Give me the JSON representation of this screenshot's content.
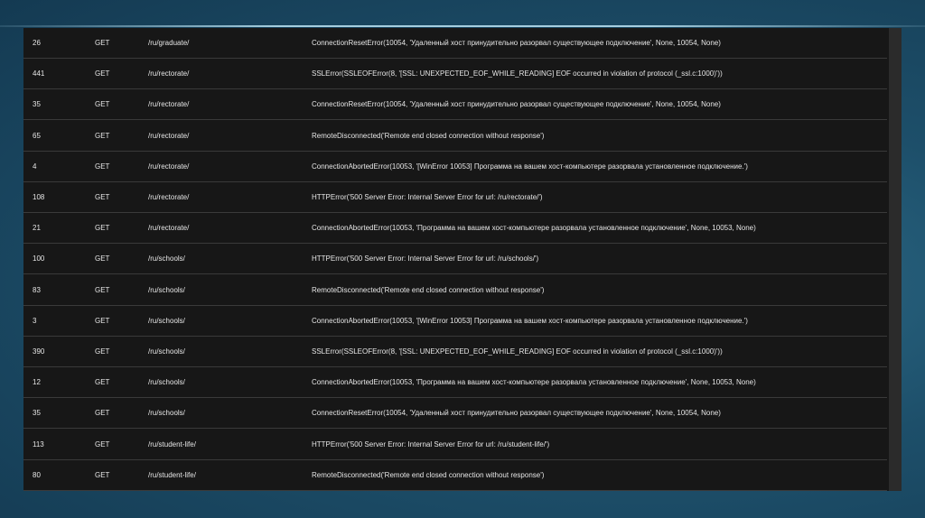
{
  "rows": [
    {
      "count": "26",
      "method": "GET",
      "url": "/ru/graduate/",
      "error": "ConnectionResetError(10054, 'Удаленный хост принудительно разорвал существующее подключение', None, 10054, None)"
    },
    {
      "count": "441",
      "method": "GET",
      "url": "/ru/rectorate/",
      "error": "SSLError(SSLEOFError(8, '[SSL: UNEXPECTED_EOF_WHILE_READING] EOF occurred in violation of protocol (_ssl.c:1000)'))"
    },
    {
      "count": "35",
      "method": "GET",
      "url": "/ru/rectorate/",
      "error": "ConnectionResetError(10054, 'Удаленный хост принудительно разорвал существующее подключение', None, 10054, None)"
    },
    {
      "count": "65",
      "method": "GET",
      "url": "/ru/rectorate/",
      "error": "RemoteDisconnected('Remote end closed connection without response')"
    },
    {
      "count": "4",
      "method": "GET",
      "url": "/ru/rectorate/",
      "error": "ConnectionAbortedError(10053, '[WinError 10053] Программа на вашем хост-компьютере разорвала установленное подключение.')"
    },
    {
      "count": "108",
      "method": "GET",
      "url": "/ru/rectorate/",
      "error": "HTTPError('500 Server Error: Internal Server Error for url: /ru/rectorate/')"
    },
    {
      "count": "21",
      "method": "GET",
      "url": "/ru/rectorate/",
      "error": "ConnectionAbortedError(10053, 'Программа на вашем хост-компьютере разорвала установленное подключение', None, 10053, None)"
    },
    {
      "count": "100",
      "method": "GET",
      "url": "/ru/schools/",
      "error": "HTTPError('500 Server Error: Internal Server Error for url: /ru/schools/')"
    },
    {
      "count": "83",
      "method": "GET",
      "url": "/ru/schools/",
      "error": "RemoteDisconnected('Remote end closed connection without response')"
    },
    {
      "count": "3",
      "method": "GET",
      "url": "/ru/schools/",
      "error": "ConnectionAbortedError(10053, '[WinError 10053] Программа на вашем хост-компьютере разорвала установленное подключение.')"
    },
    {
      "count": "390",
      "method": "GET",
      "url": "/ru/schools/",
      "error": "SSLError(SSLEOFError(8, '[SSL: UNEXPECTED_EOF_WHILE_READING] EOF occurred in violation of protocol (_ssl.c:1000)'))"
    },
    {
      "count": "12",
      "method": "GET",
      "url": "/ru/schools/",
      "error": "ConnectionAbortedError(10053, 'Программа на вашем хост-компьютере разорвала установленное подключение', None, 10053, None)"
    },
    {
      "count": "35",
      "method": "GET",
      "url": "/ru/schools/",
      "error": "ConnectionResetError(10054, 'Удаленный хост принудительно разорвал существующее подключение', None, 10054, None)"
    },
    {
      "count": "113",
      "method": "GET",
      "url": "/ru/student-life/",
      "error": "HTTPError('500 Server Error: Internal Server Error for url: /ru/student-life/')"
    },
    {
      "count": "80",
      "method": "GET",
      "url": "/ru/student-life/",
      "error": "RemoteDisconnected('Remote end closed connection without response')"
    }
  ]
}
